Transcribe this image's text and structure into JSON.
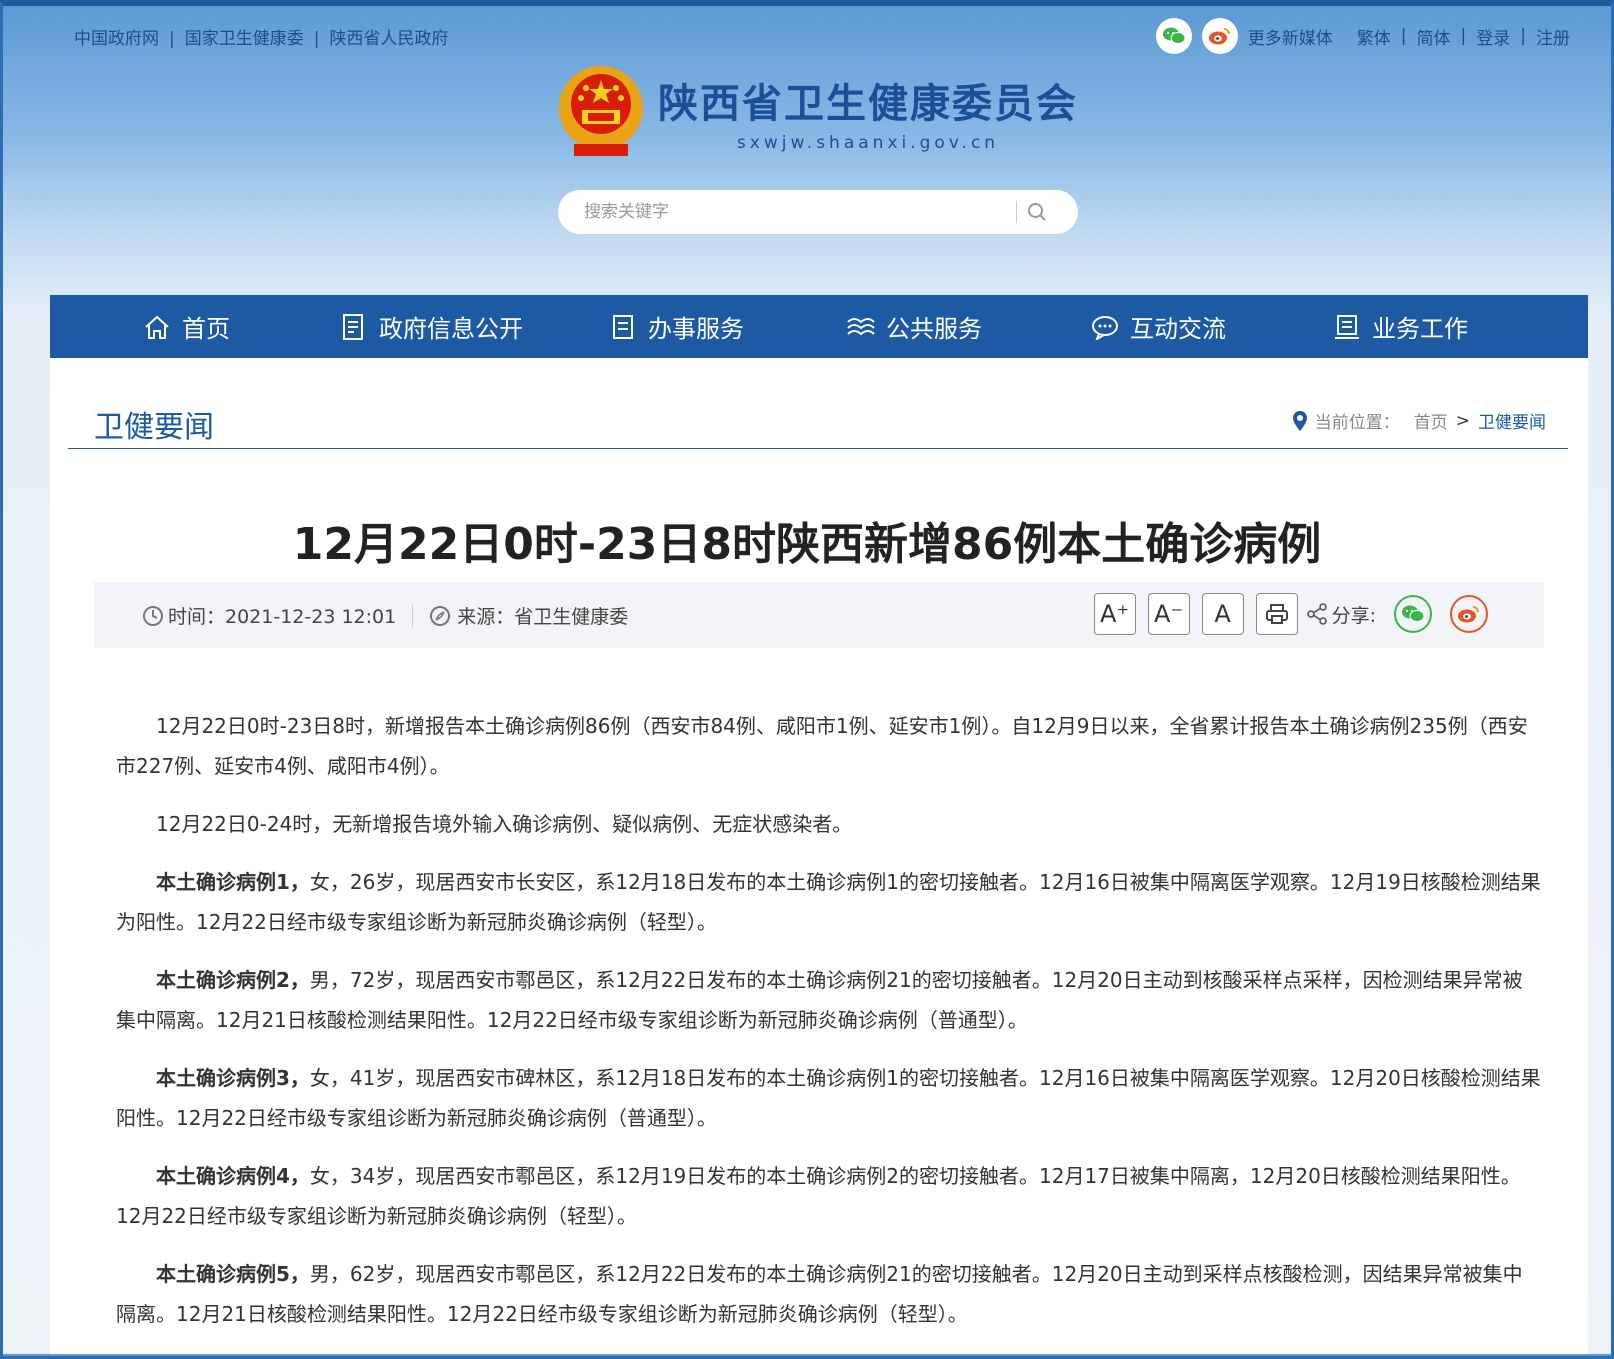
{
  "top_links": [
    "中国政府网",
    "国家卫生健康委",
    "陕西省人民政府"
  ],
  "top_right": {
    "more_media": "更多新媒体",
    "traditional": "繁体",
    "simplified": "简体",
    "login": "登录",
    "register": "注册"
  },
  "header": {
    "title": "陕西省卫生健康委员会",
    "url": "sxwjw.shaanxi.gov.cn"
  },
  "search": {
    "placeholder": "搜索关键字"
  },
  "nav": [
    "首页",
    "政府信息公开",
    "办事服务",
    "公共服务",
    "互动交流",
    "业务工作"
  ],
  "section": {
    "title": "卫健要闻",
    "breadcrumb_label": "当前位置：",
    "breadcrumb_home": "首页",
    "breadcrumb_gt": ">",
    "breadcrumb_current": "卫健要闻"
  },
  "article": {
    "title": "12月22日0时-23日8时陕西新增86例本土确诊病例",
    "time": "时间：2021-12-23 12:01",
    "source": "来源：省卫生健康委",
    "font_buttons": [
      "A⁺",
      "A⁻",
      "A"
    ],
    "share_label": "分享:",
    "paragraphs": [
      {
        "bold": "",
        "text": "12月22日0时-23日8时，新增报告本土确诊病例86例（西安市84例、咸阳市1例、延安市1例）。自12月9日以来，全省累计报告本土确诊病例235例（西安市227例、延安市4例、咸阳市4例）。"
      },
      {
        "bold": "",
        "text": "12月22日0-24时，无新增报告境外输入确诊病例、疑似病例、无症状感染者。"
      },
      {
        "bold": "本土确诊病例1，",
        "text": "女，26岁，现居西安市长安区，系12月18日发布的本土确诊病例1的密切接触者。12月16日被集中隔离医学观察。12月19日核酸检测结果为阳性。12月22日经市级专家组诊断为新冠肺炎确诊病例（轻型）。"
      },
      {
        "bold": "本土确诊病例2，",
        "text": "男，72岁，现居西安市鄠邑区，系12月22日发布的本土确诊病例21的密切接触者。12月20日主动到核酸采样点采样，因检测结果异常被集中隔离。12月21日核酸检测结果阳性。12月22日经市级专家组诊断为新冠肺炎确诊病例（普通型）。"
      },
      {
        "bold": "本土确诊病例3，",
        "text": "女，41岁，现居西安市碑林区，系12月18日发布的本土确诊病例1的密切接触者。12月16日被集中隔离医学观察。12月20日核酸检测结果阳性。12月22日经市级专家组诊断为新冠肺炎确诊病例（普通型）。"
      },
      {
        "bold": "本土确诊病例4，",
        "text": "女，34岁，现居西安市鄠邑区，系12月19日发布的本土确诊病例2的密切接触者。12月17日被集中隔离，12月20日核酸检测结果阳性。12月22日经市级专家组诊断为新冠肺炎确诊病例（轻型）。"
      },
      {
        "bold": "本土确诊病例5，",
        "text": "男，62岁，现居西安市鄠邑区，系12月22日发布的本土确诊病例21的密切接触者。12月20日主动到采样点核酸检测，因结果异常被集中隔离。12月21日核酸检测结果阳性。12月22日经市级专家组诊断为新冠肺炎确诊病例（轻型）。"
      }
    ]
  },
  "colors": {
    "nav_bg": "#1d5aa3",
    "wechat": "#3bb54a",
    "weibo": "#e8532a"
  }
}
